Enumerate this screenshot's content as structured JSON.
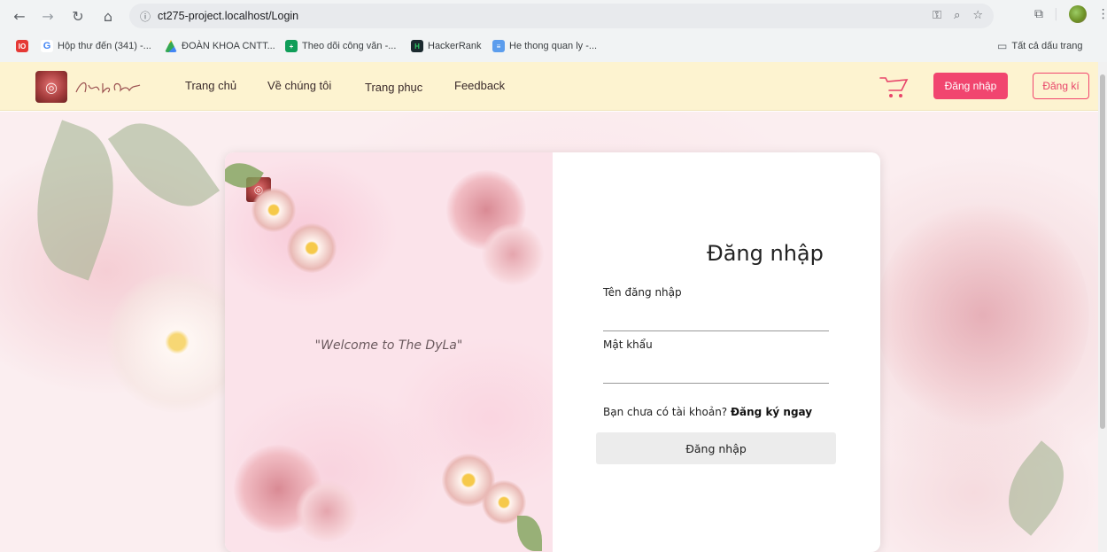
{
  "browser": {
    "url": "ct275-project.localhost/Login",
    "bookmarks": [
      {
        "label": "Hộp thư đến (341) -...",
        "icon": "gmail-icon"
      },
      {
        "label": "ĐOÀN KHOA CNTT...",
        "icon": "drive-icon"
      },
      {
        "label": "Theo dõi công văn -...",
        "icon": "sheets-icon"
      },
      {
        "label": "HackerRank",
        "icon": "hackerrank-icon"
      },
      {
        "label": "He thong quan ly -...",
        "icon": "folder-icon"
      }
    ],
    "all_bookmarks_label": "Tất cả dấu trang"
  },
  "header": {
    "nav": [
      "Trang chủ",
      "Về chúng tôi",
      "Trang phục",
      "Feedback"
    ],
    "login_label": "Đăng nhập",
    "register_label": "Đăng kí"
  },
  "card": {
    "welcome": "\"Welcome to The DyLa\"",
    "title": "Đăng nhập",
    "username_label": "Tên đăng nhập",
    "password_label": "Mật khẩu",
    "no_account_text": "Bạn chưa có tài khoản? ",
    "signup_link": "Đăng ký ngay",
    "submit_label": "Đăng nhập"
  },
  "colors": {
    "header_bg": "#fdf3d0",
    "accent": "#f1456f"
  }
}
